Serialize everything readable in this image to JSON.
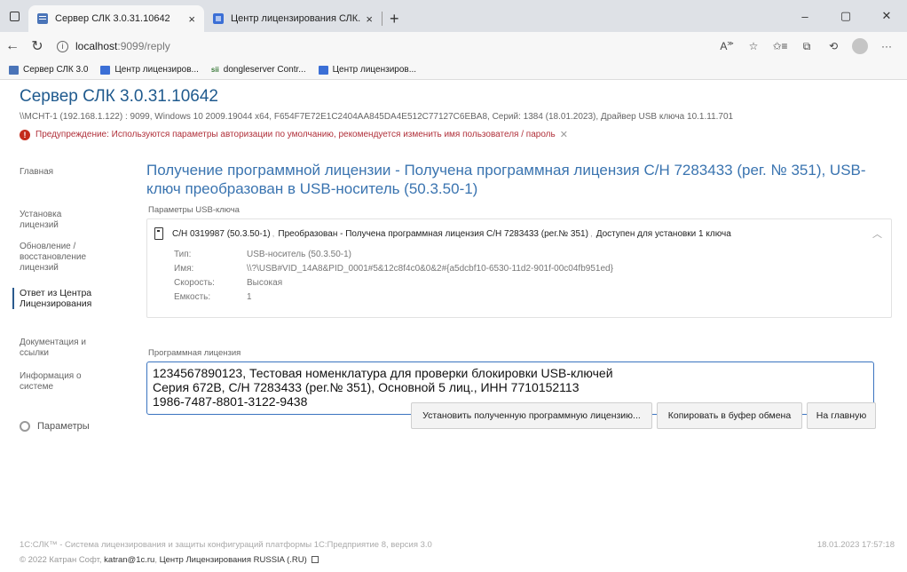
{
  "browser": {
    "tabs": [
      {
        "title": "Сервер СЛК 3.0.31.10642",
        "active": true
      },
      {
        "title": "Центр лицензирования СЛК.RU",
        "active": false
      }
    ],
    "tab_close": "×",
    "new_tab": "+",
    "window_controls": {
      "minimize": "–",
      "maximize": "▢",
      "close": "✕"
    },
    "url_host": "localhost",
    "url_path": ":9099/reply",
    "bookmarks": [
      {
        "label": "Сервер СЛК 3.0",
        "icon": "doc-icon"
      },
      {
        "label": "Центр лицензиров...",
        "icon": "page-icon"
      },
      {
        "label": "dongleserver Contr...",
        "icon": "sii-icon",
        "prefix": "sii"
      },
      {
        "label": "Центр лицензиров...",
        "icon": "page-icon"
      }
    ]
  },
  "header": {
    "title": "Сервер СЛК 3.0.31.10642",
    "info": "\\\\MCHT-1 (192.168.1.122) : 9099,  Windows 10 2009.19044 x64,  F654F7E72E1C2404AA845DA4E512C77127C6EBA8,  Серий: 1384 (18.01.2023),  Драйвер USB ключа 10.1.11.701",
    "warning": "Предупреждение: Используются параметры авторизации по умолчанию, рекомендуется изменить имя пользователя / пароль"
  },
  "sidebar": {
    "items": [
      {
        "label": "Главная",
        "active": false
      },
      {
        "label": "Установка\nлицензий",
        "active": false
      },
      {
        "label": "Обновление /\nвосстановление\nлицензий",
        "active": false
      },
      {
        "label": "Ответ из Центра\nЛицензирования",
        "active": true
      },
      {
        "label": "Документация и\nссылки",
        "active": false
      },
      {
        "label": "Информация о\nсистеме",
        "active": false
      }
    ],
    "params_label": "Параметры"
  },
  "main": {
    "title": "Получение программной лицензии - Получена программная лицензия С/Н 7283433 (рег. № 351), USB-ключ преобразован в USB-носитель (50.3.50-1)",
    "usb_section_label": "Параметры USB-ключа",
    "usb_key": {
      "serial": "С/Н 0319987 (50.3.50-1)",
      "status": "Преобразован - Получена программная лицензия С/Н 7283433 (рег.№ 351)",
      "available": "Доступен для установки 1 ключа",
      "fields": [
        {
          "k": "Тип:",
          "v": "USB-носитель (50.3.50-1)"
        },
        {
          "k": "Имя:",
          "v": "\\\\?\\USB#VID_14A8&PID_0001#5&12c8f4c0&0&2#{a5dcbf10-6530-11d2-901f-00c04fb951ed}"
        },
        {
          "k": "Скорость:",
          "v": "Высокая"
        },
        {
          "k": "Емкость:",
          "v": "1"
        }
      ]
    },
    "license_section_label": "Программная лицензия",
    "license_text": "1234567890123, Тестовая номенклатура для проверки блокировки USB-ключей\nСерия 672В, С/Н 7283433 (рег.№ 351), Основной 5 лиц., ИНН 7710152113\n1986-7487-8801-3122-9438",
    "buttons": {
      "install": "Установить полученную программную лицензию...",
      "copy": "Копировать в буфер обмена",
      "home": "На главную"
    }
  },
  "footer": {
    "line1": "1С:СЛК™ - Система лицензирования и защиты конфигураций платформы 1С:Предприятие 8, версия 3.0",
    "datetime": "18.01.2023 17:57:18",
    "copyright": "© 2022 Катран Софт,",
    "email": "katran@1c.ru",
    "center_link": "Центр Лицензирования RUSSIA (.RU)"
  }
}
